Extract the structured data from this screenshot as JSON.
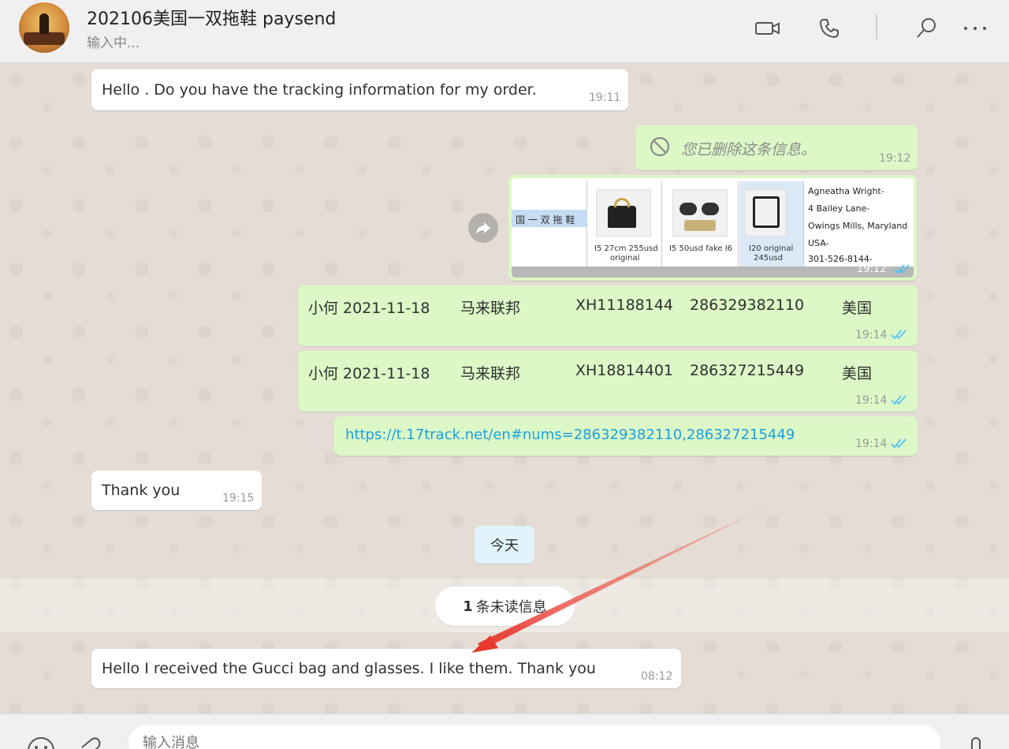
{
  "header": {
    "chat_name": "202106美国一双拖鞋 paysend",
    "status": "输入中..."
  },
  "messages": [
    {
      "dir": "in",
      "text": "Hello . Do you have the tracking information for my order.",
      "time": "19:11"
    },
    {
      "dir": "out",
      "deleted_text": "您已删除这条信息。",
      "time": "19:12"
    },
    {
      "dir": "out",
      "type": "image",
      "sheet": {
        "tab_label": "国 一 双 拖 鞋",
        "items": [
          {
            "caption1": "I5  27cm 255usd",
            "caption2": "original"
          },
          {
            "caption1": "I5  50usd  fake I6",
            "caption2": ""
          },
          {
            "caption1": "I20 original",
            "caption2": "245usd"
          }
        ],
        "address": [
          "Agneatha Wright-",
          "4 Bailey Lane-",
          "Owings Mills, Maryland",
          "USA-",
          "301-526-8144-"
        ]
      },
      "time": "19:12"
    },
    {
      "dir": "out",
      "cols": [
        "小何 2021-11-18",
        "马来联邦",
        "XH11188144",
        "286329382110",
        "美国"
      ],
      "time": "19:14"
    },
    {
      "dir": "out",
      "cols": [
        "小何 2021-11-18",
        "马来联邦",
        "XH18814401",
        "286327215449",
        "美国"
      ],
      "time": "19:14"
    },
    {
      "dir": "out",
      "link": "https://t.17track.net/en#nums=286329382110,286327215449",
      "time": "19:14"
    },
    {
      "dir": "in",
      "text": "Thank you",
      "time": "19:15"
    },
    {
      "dir": "in",
      "text": "Hello I received the Gucci bag and glasses. I like them. Thank you",
      "time": "08:12"
    }
  ],
  "date_divider": "今天",
  "unread": {
    "count": "1",
    "label": "条未读信息"
  },
  "composer": {
    "placeholder": "输入消息"
  },
  "colors": {
    "outgoing": "#dcf8c6",
    "incoming": "#ffffff",
    "link": "#1ba0e0",
    "tick": "#4fc3f7",
    "arrow": "#e8392f"
  }
}
